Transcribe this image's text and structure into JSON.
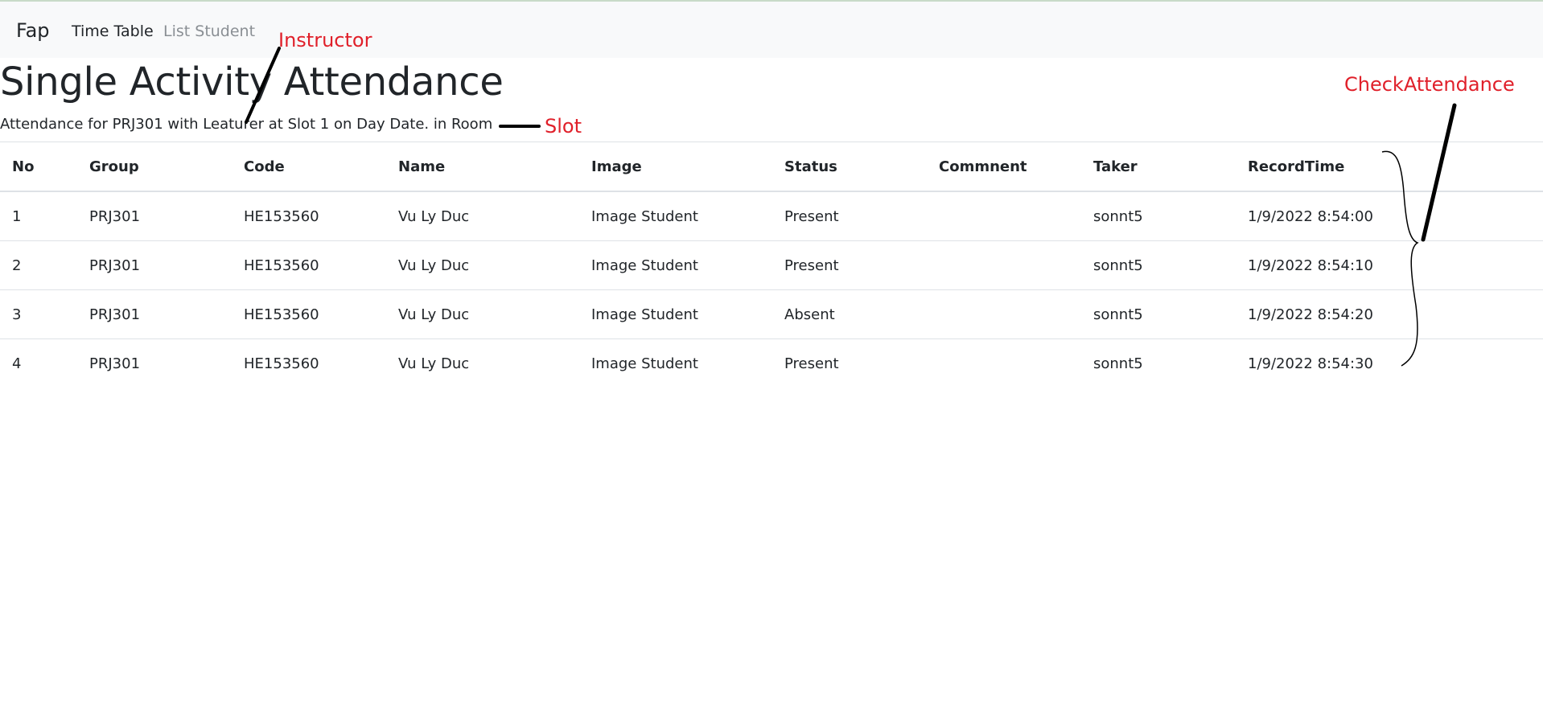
{
  "nav": {
    "brand": "Fap",
    "links": [
      "Time Table",
      "List Student"
    ]
  },
  "page": {
    "title": "Single Activity Attendance",
    "subtitle": "Attendance for PRJ301 with Leaturer at Slot 1 on Day Date. in Room"
  },
  "table": {
    "headers": [
      "No",
      "Group",
      "Code",
      "Name",
      "Image",
      "Status",
      "Commnent",
      "Taker",
      "RecordTime"
    ],
    "rows": [
      [
        "1",
        "PRJ301",
        "HE153560",
        "Vu Ly Duc",
        "Image Student",
        "Present",
        "",
        "sonnt5",
        "1/9/2022 8:54:00"
      ],
      [
        "2",
        "PRJ301",
        "HE153560",
        "Vu Ly Duc",
        "Image Student",
        "Present",
        "",
        "sonnt5",
        "1/9/2022 8:54:10"
      ],
      [
        "3",
        "PRJ301",
        "HE153560",
        "Vu Ly Duc",
        "Image Student",
        "Absent",
        "",
        "sonnt5",
        "1/9/2022 8:54:20"
      ],
      [
        "4",
        "PRJ301",
        "HE153560",
        "Vu Ly Duc",
        "Image Student",
        "Present",
        "",
        "sonnt5",
        "1/9/2022 8:54:30"
      ]
    ]
  },
  "annotations": {
    "instructor": "Instructor",
    "slot": "Slot",
    "check_attendance": "CheckAttendance",
    "color": "#e0202a"
  }
}
